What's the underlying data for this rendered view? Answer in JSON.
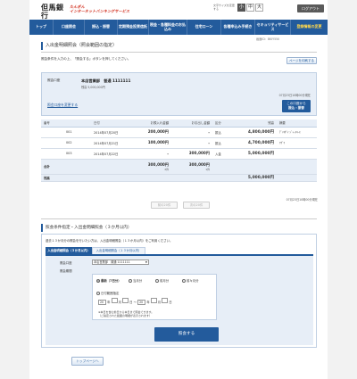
{
  "header": {
    "bank_name": "但馬銀行",
    "bank_name_en": "TAJIMA BANK",
    "service_line1": "たんぎん",
    "service_line2": "インターネットバンキングサービス",
    "font_size_label": "文字サイズを変更する",
    "font_sizes": [
      "小",
      "中",
      "大"
    ],
    "logout": "ログアウト"
  },
  "nav": [
    "トップ",
    "口座照会",
    "振込・振替",
    "定期預金投資信託",
    "税金・各種料金のお払込み",
    "住宅ローン",
    "各種申込み手続き",
    "セキュリティサービス",
    "登録情報の変更"
  ],
  "page": {
    "breadcrumb": "画面ID：BKIY550",
    "title": "入出金明細照会（照会範囲の指定）",
    "instruction": "照会条件を入力の上、「照会する」ボタンを押してください。",
    "print_button": "ページを印刷する"
  },
  "account": {
    "label": "照会口座",
    "value": "本店営業部　普通 1111111",
    "balance_label": "残高",
    "balance": "5,000,000円",
    "as_of": "07月23日10時00分現在",
    "change_link": "照会口座を変更する",
    "transfer_btn_l1": "この口座から",
    "transfer_btn_l2": "振込・振替"
  },
  "table": {
    "headers": [
      "番号",
      "日付",
      "お預入れ金額",
      "お引出し金額",
      "区分",
      "残高",
      "摘要"
    ],
    "rows": [
      {
        "no": "001",
        "date": "2014年07月20日",
        "deposit": "200,000円",
        "withdraw": "-",
        "kind": "振込",
        "balance": "4,800,000円",
        "memo": "ﾃﾞﾝｷﾀﾞｲ ｼﾞｬｰｽ‌ｺｰｽ"
      },
      {
        "no": "002",
        "date": "2014年07月21日",
        "deposit": "100,000円",
        "withdraw": "-",
        "kind": "振込",
        "balance": "4,700,000円",
        "memo": "ｱｶﾞﾏ"
      },
      {
        "no": "003",
        "date": "2014年07月22日",
        "deposit": "-",
        "withdraw": "300,000円",
        "kind": "入金",
        "balance": "5,000,000円",
        "memo": ""
      }
    ],
    "sum_label": "合計",
    "sum_deposit": "300,000円",
    "sum_deposit_count": "2件",
    "sum_withdraw": "300,000円",
    "sum_withdraw_count": "1件",
    "zan_label": "残高",
    "zan_value": "5,000,000円",
    "as_of": "07月23日10時00分現在",
    "prev": "前の20件",
    "next": "次の20件"
  },
  "section2": {
    "title": "照会条件指定・入出金明細照会（３か月以内）",
    "note": "過去１３か月分の照会を行いたい方は、入出金明細照会（１３か月以内）をご利用ください。",
    "tab_active": "入出金明細照会（３か月以内）",
    "tab_inactive": "入出金明細照会（１３か月以内）",
    "account_label": "照会口座",
    "account_select": "本店営業部　普通 1111111",
    "period_label": "照会期間",
    "radio_latest": "最新（7日分）",
    "radio_this_month": "当月分",
    "radio_last_month": "前月分",
    "radio_two_months_ago": "前々月分",
    "radio_date": "日付範囲指定",
    "from_year": "20",
    "to_year": "20",
    "unit_year": "年",
    "unit_month": "月",
    "unit_day": "日",
    "range_mark": "〜",
    "note2": "※本日を含む前日から本日まで照会できます。",
    "note3": "（ご指定された範囲の明細が表示されます）",
    "submit": "照会する"
  },
  "footer": {
    "top_btn": "トップページへ"
  }
}
